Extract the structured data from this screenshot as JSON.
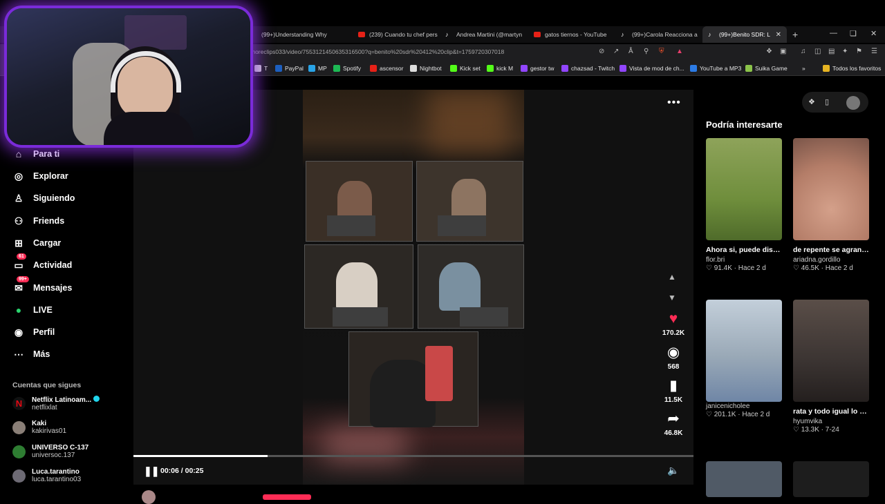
{
  "browser": {
    "tabs": [
      {
        "label": "(99+)Understanding Why",
        "icon": "tiktok",
        "active": false
      },
      {
        "label": "(239) Cuando tu chef pers",
        "icon": "youtube",
        "active": false
      },
      {
        "label": "Andrea Martini (@martyn",
        "icon": "tiktok",
        "active": false
      },
      {
        "label": "gatos tiernos - YouTube",
        "icon": "youtube",
        "active": false
      },
      {
        "label": "(99+)Carola Reacciona a",
        "icon": "tiktok",
        "active": false
      },
      {
        "label": "(99+)Benito SDR: L",
        "icon": "tiktok",
        "active": true
      }
    ],
    "new_tab": "+",
    "url": "moreclips033/video/7553121450635316500?q=benito%20sdr%20412%20clip&t=1759720307018",
    "bookmarks": [
      {
        "label": "T",
        "color": "#cccccc"
      },
      {
        "label": "PayPal",
        "color": "#1d5fbf"
      },
      {
        "label": "MP",
        "color": "#29a3e6"
      },
      {
        "label": "Spotify",
        "color": "#1db954"
      },
      {
        "label": "ascensor",
        "color": "#e62117"
      },
      {
        "label": "Nightbot",
        "color": "#dddddd"
      },
      {
        "label": "Kick set",
        "color": "#53fc18"
      },
      {
        "label": "kick M",
        "color": "#53fc18"
      },
      {
        "label": "gestor tw",
        "color": "#9146ff"
      },
      {
        "label": "chazsad - Twitch",
        "color": "#9146ff"
      },
      {
        "label": "Vista de mod de ch...",
        "color": "#9146ff"
      },
      {
        "label": "YouTube a MP3",
        "color": "#2c7be5"
      },
      {
        "label": "Suika Game",
        "color": "#8bc34a"
      }
    ],
    "bookmarks_more": "»",
    "all_favorites": "Todos los favoritos"
  },
  "sidebar": {
    "items": [
      {
        "label": "Para ti",
        "icon": "home-icon",
        "badge": ""
      },
      {
        "label": "Explorar",
        "icon": "compass-icon",
        "badge": ""
      },
      {
        "label": "Siguiendo",
        "icon": "following-icon",
        "badge": ""
      },
      {
        "label": "Friends",
        "icon": "friends-icon",
        "badge": ""
      },
      {
        "label": "Cargar",
        "icon": "upload-icon",
        "badge": ""
      },
      {
        "label": "Actividad",
        "icon": "activity-icon",
        "badge": "61"
      },
      {
        "label": "Mensajes",
        "icon": "messages-icon",
        "badge": "99+"
      },
      {
        "label": "LIVE",
        "icon": "live-icon",
        "badge": ""
      },
      {
        "label": "Perfil",
        "icon": "profile-icon",
        "badge": ""
      },
      {
        "label": "Más",
        "icon": "more-icon",
        "badge": ""
      }
    ],
    "following_title": "Cuentas que sigues",
    "following": [
      {
        "name": "Netflix Latinoam...",
        "handle": "netflixlat",
        "color": "#111111"
      },
      {
        "name": "Kaki",
        "handle": "kakirivas01",
        "color": "#8a7f77"
      },
      {
        "name": "UNIVERSO C-137",
        "handle": "universoc.137",
        "color": "#2e7d32"
      },
      {
        "name": "Luca.tarantino",
        "handle": "luca.tarantino03",
        "color": "#6d6a74"
      }
    ]
  },
  "player": {
    "time": "00:06 / 00:25",
    "progress": 0.24,
    "actions": {
      "likes": "170.2K",
      "comments": "568",
      "saves": "11.5K",
      "shares": "46.8K"
    }
  },
  "suggestions": {
    "title": "Podría interesarte",
    "cards": [
      {
        "title": "Ahora si, puede disfrutar del patio...",
        "user": "flor.bri",
        "likes": "91.4K",
        "when": "Hace 2 d",
        "thumb": "#6f8e3c"
      },
      {
        "title": "de repente se agranda la familia d...",
        "user": "ariadna.gordillo",
        "likes": "46.5K",
        "when": "Hace 2 d",
        "thumb": "#c99784"
      },
      {
        "title": "",
        "user": "janicenicholee",
        "likes": "201.1K",
        "when": "Hace 2 d",
        "thumb": "#9aa9b7"
      },
      {
        "title": "rata y todo igual lo amo djskdjd #hum...",
        "user": "hyumvika",
        "likes": "13.3K",
        "when": "7-24",
        "thumb": "#3b3432"
      }
    ]
  }
}
